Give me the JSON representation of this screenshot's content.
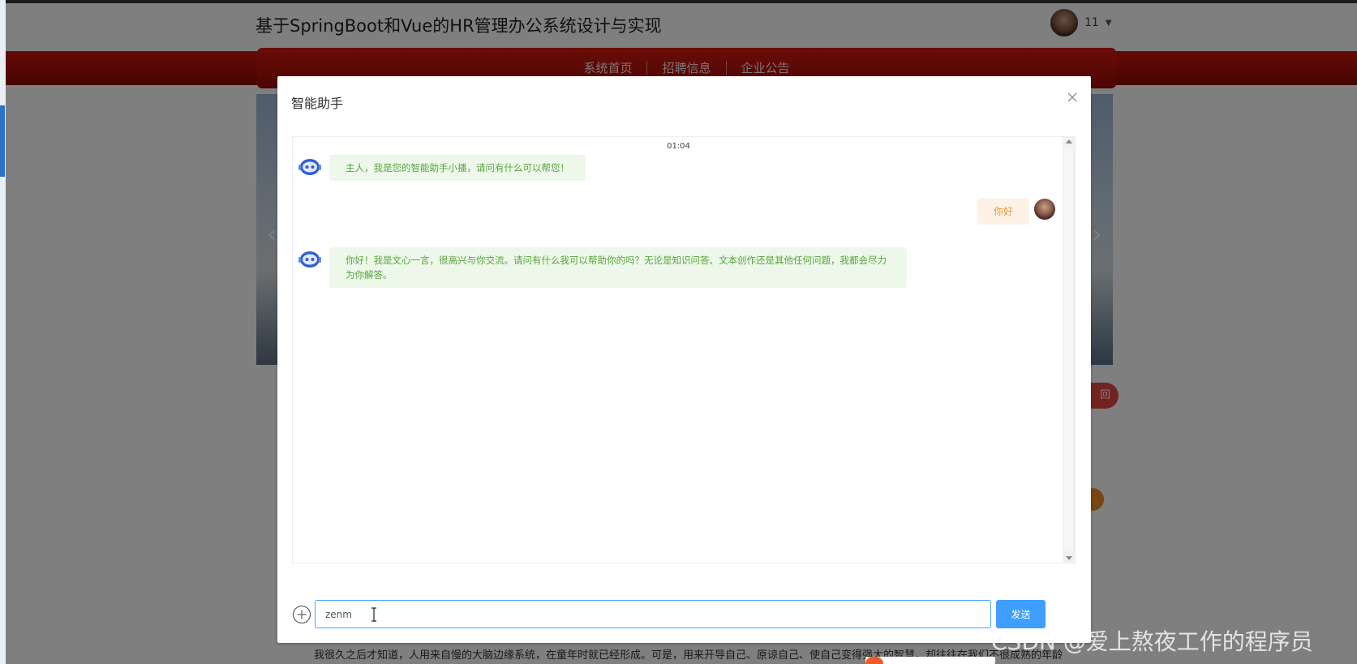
{
  "site": {
    "title": "基于SpringBoot和Vue的HR管理办公系统设计与实现",
    "user_name": "11"
  },
  "nav": {
    "items": [
      "系统首页",
      "招聘信息",
      "企业公告"
    ]
  },
  "page_content": {
    "pill_button_label": "回",
    "article_line": "我很久之后才知道，人用来自慢的大脑边缘系统，在童年时就已经形成。可是，用来开导自己、原谅自己、使自己变得强大的智慧，却往往在我们不很成熟的年龄"
  },
  "dialog": {
    "title": "智能助手",
    "timestamp": "01:04",
    "messages": [
      {
        "from": "bot",
        "text": "主人，我是您的智能助手小播，请问有什么可以帮您！"
      },
      {
        "from": "user",
        "text": "你好"
      },
      {
        "from": "bot",
        "text": "你好！我是文心一言，很高兴与你交流。请问有什么我可以帮助你的吗？无论是知识问答、文本创作还是其他任何问题，我都会尽力为你解答。"
      }
    ],
    "input_value": "zenm",
    "send_label": "发送"
  },
  "watermark": "CSDN @爱上熬夜工作的程序员",
  "colors": {
    "nav_red": "#c8160e",
    "send_blue": "#409eff",
    "bot_bubble": "#edf8ea",
    "bot_text": "#5aa33e",
    "user_bubble": "#fdf2e5",
    "user_text": "#e39a3e"
  },
  "icons": {
    "close": "close-icon",
    "plus": "plus-circle-icon",
    "bot": "robot-icon",
    "caret": "caret-down-icon"
  }
}
